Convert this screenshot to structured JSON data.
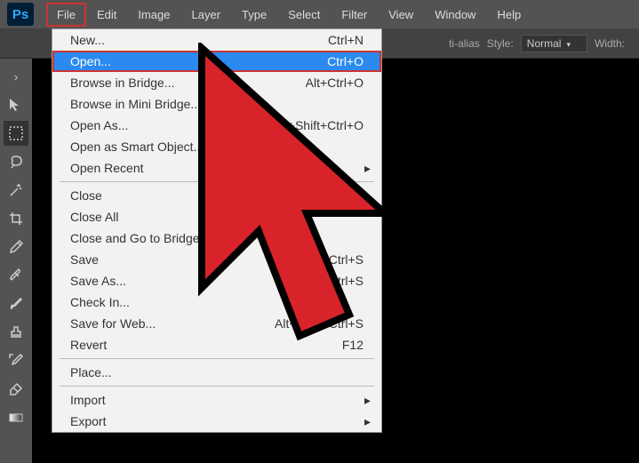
{
  "menubar": {
    "items": [
      "File",
      "Edit",
      "Image",
      "Layer",
      "Type",
      "Select",
      "Filter",
      "View",
      "Window",
      "Help"
    ],
    "highlighted_index": 0
  },
  "toolbar": {
    "antialias_label": "ti-alias",
    "style_label": "Style:",
    "style_value": "Normal",
    "width_label": "Width:"
  },
  "dropdown": {
    "groups": [
      [
        {
          "label": "New...",
          "shortcut": "Ctrl+N"
        },
        {
          "label": "Open...",
          "shortcut": "Ctrl+O",
          "highlighted": true
        },
        {
          "label": "Browse in Bridge...",
          "shortcut": "Alt+Ctrl+O"
        },
        {
          "label": "Browse in Mini Bridge..."
        },
        {
          "label": "Open As...",
          "shortcut": "Alt+Shift+Ctrl+O"
        },
        {
          "label": "Open as Smart Object..."
        },
        {
          "label": "Open Recent",
          "submenu": true
        }
      ],
      [
        {
          "label": "Close"
        },
        {
          "label": "Close All"
        },
        {
          "label": "Close and Go to Bridge..."
        },
        {
          "label": "Save",
          "shortcut": "Ctrl+S"
        },
        {
          "label": "Save As...",
          "shortcut": "Shift+Ctrl+S"
        },
        {
          "label": "Check In..."
        },
        {
          "label": "Save for Web...",
          "shortcut": "Alt+Shift+Ctrl+S"
        },
        {
          "label": "Revert",
          "shortcut": "F12"
        }
      ],
      [
        {
          "label": "Place..."
        }
      ],
      [
        {
          "label": "Import",
          "submenu": true
        },
        {
          "label": "Export",
          "submenu": true
        }
      ]
    ]
  },
  "tools": [
    {
      "name": "arrow",
      "label": "↱"
    },
    {
      "name": "move",
      "label": "✥"
    },
    {
      "name": "marquee",
      "selected": true
    },
    {
      "name": "lasso"
    },
    {
      "name": "wand"
    },
    {
      "name": "crop"
    },
    {
      "name": "eyedropper"
    },
    {
      "name": "healing"
    },
    {
      "name": "brush"
    },
    {
      "name": "stamp"
    },
    {
      "name": "history-brush"
    },
    {
      "name": "eraser"
    },
    {
      "name": "gradient"
    }
  ]
}
